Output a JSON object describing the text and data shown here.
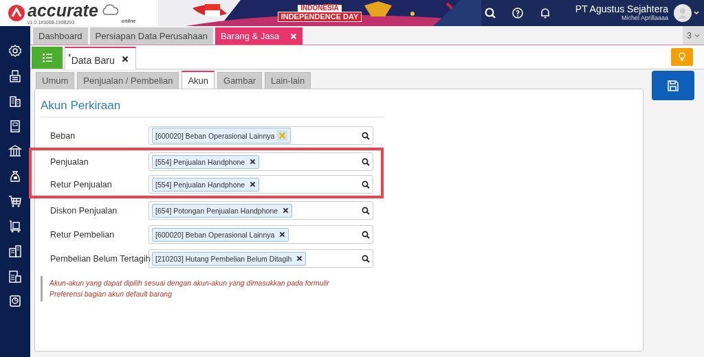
{
  "app": {
    "logo_text": "accurate",
    "logo_sub": "online",
    "version": "v1.0.1#3068-1998293",
    "banner_line1": "INDONESIA",
    "banner_line2": "INDEPENDENCE DAY",
    "company": "PT Agustus Sejahtera",
    "user": "Michel Aprillaaaa"
  },
  "module_tabs": [
    {
      "label": "Dashboard",
      "selected": false,
      "closable": false
    },
    {
      "label": "Persiapan Data Perusahaan",
      "selected": false,
      "closable": false
    },
    {
      "label": "Barang & Jasa",
      "selected": true,
      "closable": true
    }
  ],
  "tab_count": "3",
  "doc_tab": {
    "label": "Data Baru",
    "modified_mark": "*"
  },
  "form_tabs": [
    {
      "label": "Umum",
      "selected": false
    },
    {
      "label": "Penjualan / Pembelian",
      "selected": false
    },
    {
      "label": "Akun",
      "selected": true
    },
    {
      "label": "Gambar",
      "selected": false
    },
    {
      "label": "Lain-lain",
      "selected": false
    }
  ],
  "section_title": "Akun Perkiraan",
  "fields": [
    {
      "label": "Beban",
      "value": "[600020] Beban Operasional Lainnya",
      "remove_hovered": true,
      "highlighted": false
    },
    {
      "label": "Penjualan",
      "value": "[554] Penjualan Handphone",
      "remove_hovered": false,
      "highlighted": true
    },
    {
      "label": "Retur Penjualan",
      "value": "[554] Penjualan Handphone",
      "remove_hovered": false,
      "highlighted": true
    },
    {
      "label": "Diskon Penjualan",
      "value": "[654] Potongan Penjualan Handphone",
      "remove_hovered": false,
      "highlighted": false
    },
    {
      "label": "Retur Pembelian",
      "value": "[600020] Beban Operasional Lainnya",
      "remove_hovered": false,
      "highlighted": false
    },
    {
      "label": "Pembelian Belum Tertagih",
      "value": "[210203] Hutang Pembelian Belum Ditagih",
      "remove_hovered": false,
      "highlighted": false
    }
  ],
  "note": "*Akun-akun yang dapat dipilih sesuai dengan akun-akun yang dimasukkan pada formulir Preferensi bagian akun default barang*"
}
